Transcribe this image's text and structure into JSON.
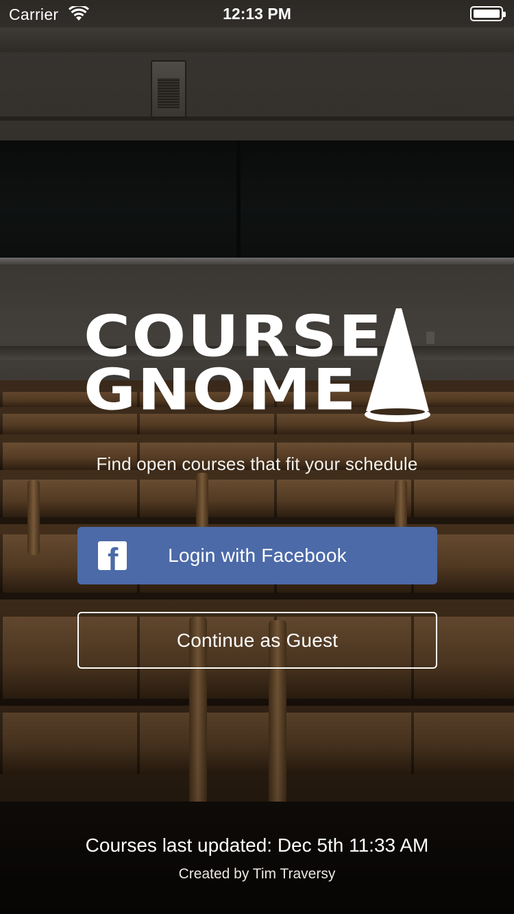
{
  "status_bar": {
    "carrier": "Carrier",
    "time": "12:13 PM",
    "wifi_icon": "wifi-icon",
    "battery_icon": "battery-icon"
  },
  "logo": {
    "line1": "COURSE",
    "line2": "GNOME",
    "icon": "gnome-hat-icon"
  },
  "tagline": "Find open courses that fit your schedule",
  "buttons": {
    "facebook_label": "Login with Facebook",
    "facebook_icon": "facebook-icon",
    "guest_label": "Continue as Guest"
  },
  "footer": {
    "last_updated": "Courses last updated: Dec 5th 11:33 AM",
    "credit": "Created by Tim Traversy"
  },
  "colors": {
    "facebook_blue": "#4c6aa8",
    "text": "#ffffff"
  }
}
